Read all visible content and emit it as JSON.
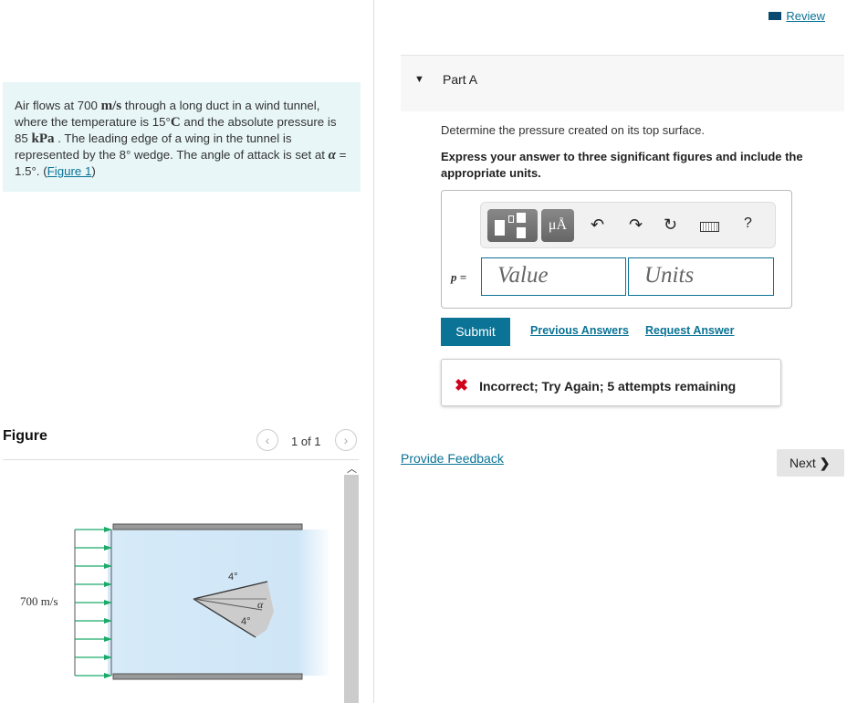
{
  "problem": {
    "t1": "Air flows at 700 ",
    "u1": "m/s",
    "t2": " through a long duct in a wind tunnel, where the temperature is 15°",
    "u2": "C",
    "t3": " and the absolute pressure is 85 ",
    "u3": "kPa",
    "t4": " . The leading edge of a wing in the tunnel is represented by the 8° wedge. The angle of attack is set at ",
    "alpha": "α",
    "t5": " = 1.5°. (",
    "link": "Figure 1",
    "t6": ")"
  },
  "header": {
    "review": "Review"
  },
  "part": {
    "title": "Part A",
    "question": "Determine the pressure created on its top surface.",
    "instruction": "Express your answer to three significant figures and include the appropriate units."
  },
  "answer": {
    "label": "p =",
    "value_placeholder": "Value",
    "units_placeholder": "Units",
    "toolbar": {
      "units_btn": "μÅ",
      "help": "?"
    }
  },
  "actions": {
    "submit": "Submit",
    "previous": "Previous Answers",
    "request": "Request Answer"
  },
  "feedback": {
    "message": "Incorrect; Try Again; 5 attempts remaining",
    "icon": "x-icon",
    "color": "#d0021b"
  },
  "provide_feedback": "Provide Feedback",
  "next": "Next",
  "figure": {
    "title": "Figure",
    "pager": "1 of 1",
    "velocity": "700 m/s",
    "angle_top": "4°",
    "angle_bottom": "4°",
    "alpha": "α"
  }
}
